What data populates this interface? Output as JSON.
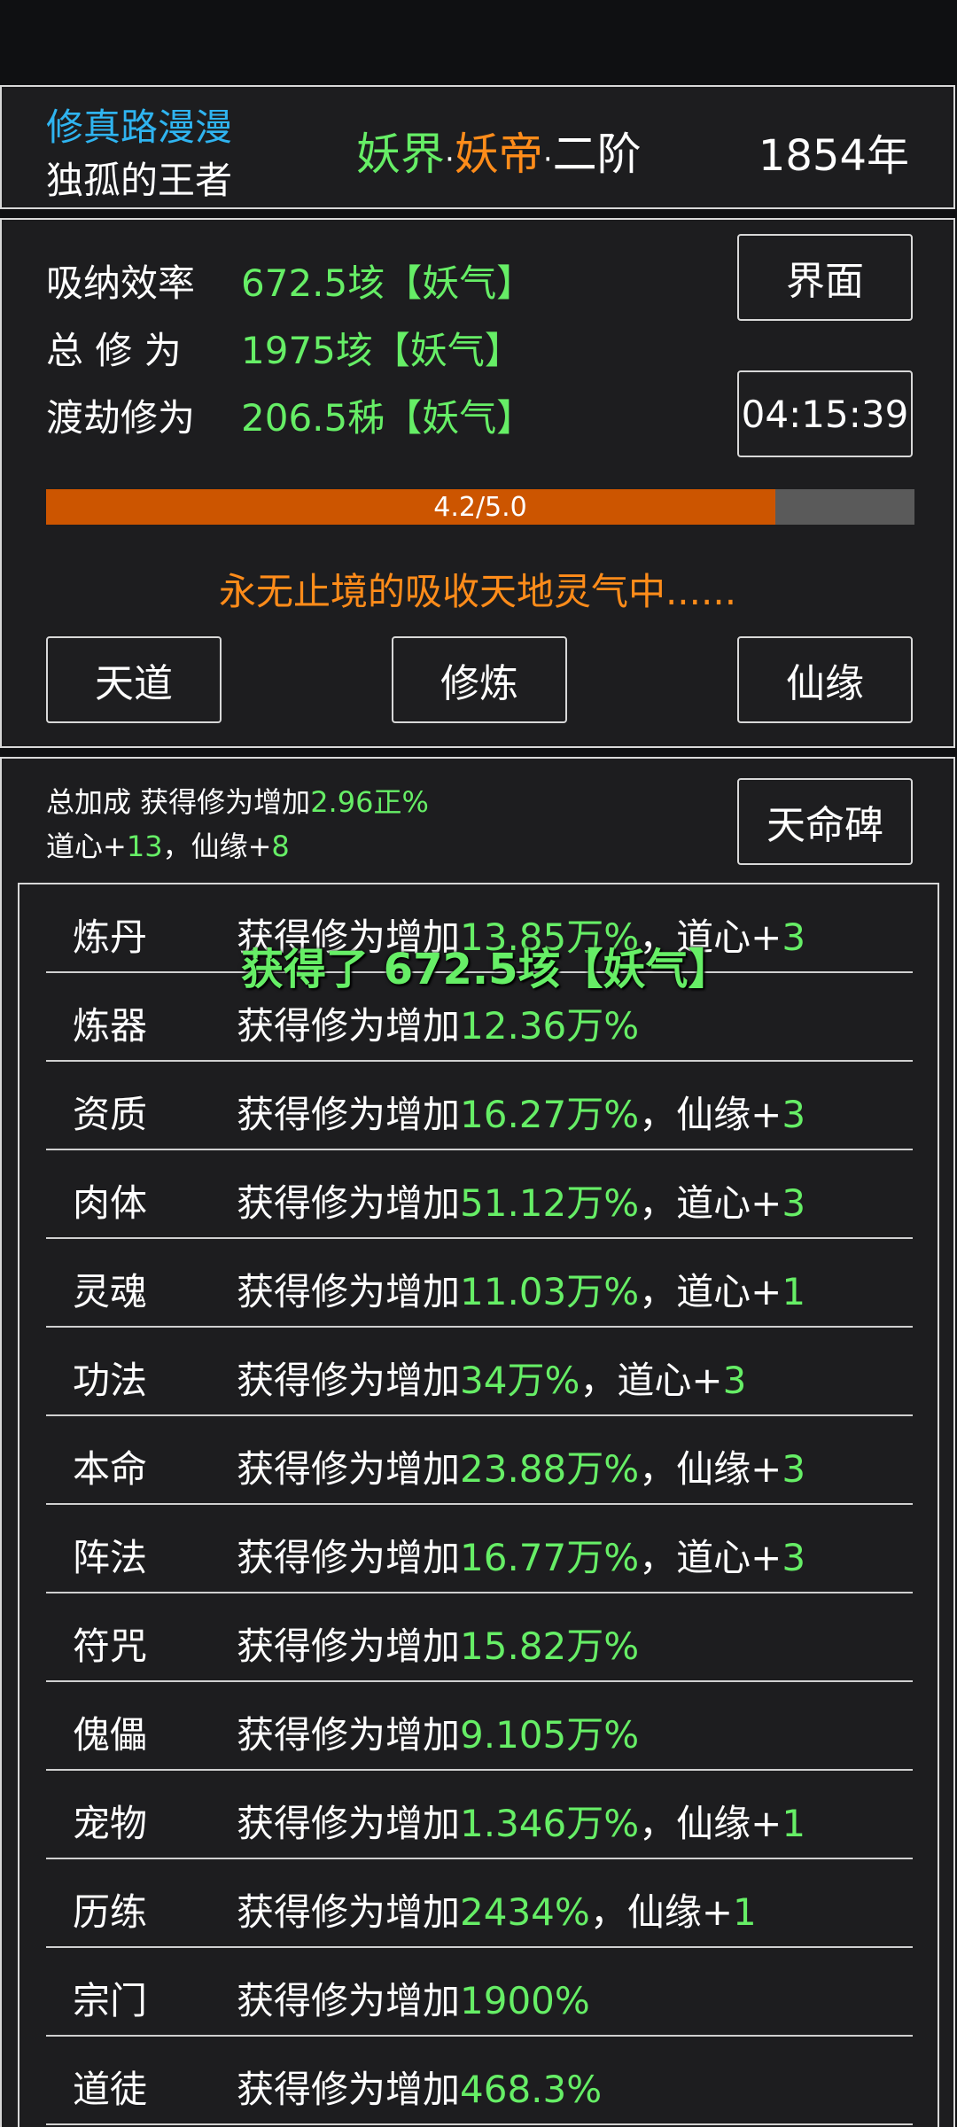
{
  "header": {
    "game_title": "修真路漫漫",
    "player_name": "独孤的王者",
    "realm_world": "妖界",
    "realm_rank": "妖帝",
    "realm_stage": "二阶",
    "separator": "·",
    "year": "1854年"
  },
  "stats": {
    "absorb_label": "吸纳效率",
    "absorb_value": "672.5垓【妖气】",
    "total_label": "总 修 为",
    "total_value": "1975垓【妖气】",
    "tribulation_label": "渡劫修为",
    "tribulation_value": "206.5秭【妖气】",
    "interface_button": "界面",
    "timer": "04:15:39"
  },
  "progress": {
    "text": "4.2/5.0",
    "value": 4.2,
    "max": 5.0,
    "color": "#cc5500"
  },
  "status_message": "永无止境的吸收天地灵气中......",
  "actions": [
    "天道",
    "修炼",
    "仙缘"
  ],
  "bonus": {
    "total_prefix": "总加成 获得修为增加",
    "total_value": "2.96正%",
    "daoxin_prefix": "道心+",
    "daoxin_value": "13",
    "sep": "，",
    "xianyuan_prefix": "仙缘+",
    "xianyuan_value": "8",
    "tianming_button": "天命碑"
  },
  "floating_message": "获得了 672.5垓【妖气】",
  "bonus_rows": [
    {
      "name": "炼丹",
      "prefix": "获得修为增加",
      "value": "13.85万%",
      "extra_prefix": "，道心+",
      "extra_value": "3"
    },
    {
      "name": "炼器",
      "prefix": "获得修为增加",
      "value": "12.36万%",
      "extra_prefix": "",
      "extra_value": ""
    },
    {
      "name": "资质",
      "prefix": "获得修为增加",
      "value": "16.27万%",
      "extra_prefix": "，仙缘+",
      "extra_value": "3"
    },
    {
      "name": "肉体",
      "prefix": "获得修为增加",
      "value": "51.12万%",
      "extra_prefix": "，道心+",
      "extra_value": "3"
    },
    {
      "name": "灵魂",
      "prefix": "获得修为增加",
      "value": "11.03万%",
      "extra_prefix": "，道心+",
      "extra_value": "1"
    },
    {
      "name": "功法",
      "prefix": "获得修为增加",
      "value": "34万%",
      "extra_prefix": "，道心+",
      "extra_value": "3"
    },
    {
      "name": "本命",
      "prefix": "获得修为增加",
      "value": "23.88万%",
      "extra_prefix": "，仙缘+",
      "extra_value": "3"
    },
    {
      "name": "阵法",
      "prefix": "获得修为增加",
      "value": "16.77万%",
      "extra_prefix": "，道心+",
      "extra_value": "3"
    },
    {
      "name": "符咒",
      "prefix": "获得修为增加",
      "value": "15.82万%",
      "extra_prefix": "",
      "extra_value": ""
    },
    {
      "name": "傀儡",
      "prefix": "获得修为增加",
      "value": "9.105万%",
      "extra_prefix": "",
      "extra_value": ""
    },
    {
      "name": "宠物",
      "prefix": "获得修为增加",
      "value": "1.346万%",
      "extra_prefix": "，仙缘+",
      "extra_value": "1"
    },
    {
      "name": "历练",
      "prefix": "获得修为增加",
      "value": "2434%",
      "extra_prefix": "，仙缘+",
      "extra_value": "1"
    },
    {
      "name": "宗门",
      "prefix": "获得修为增加",
      "value": "1900%",
      "extra_prefix": "",
      "extra_value": ""
    },
    {
      "name": "道徒",
      "prefix": "获得修为增加",
      "value": "468.3%",
      "extra_prefix": "",
      "extra_value": ""
    }
  ]
}
